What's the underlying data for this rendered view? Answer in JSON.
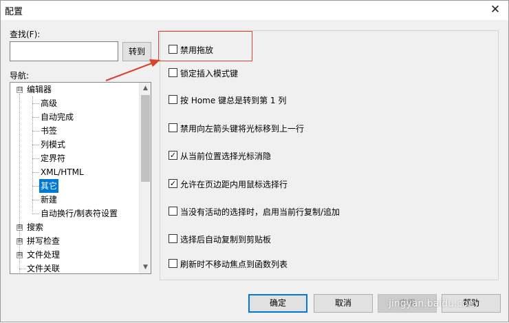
{
  "window": {
    "title": "配置",
    "close_glyph": "✕"
  },
  "search": {
    "label": "查找(F):",
    "value": "",
    "go_label": "转到"
  },
  "nav": {
    "label": "导航:",
    "items": [
      {
        "label": "编辑器",
        "expander": "⊟"
      },
      {
        "label": "高级"
      },
      {
        "label": "自动完成"
      },
      {
        "label": "书签"
      },
      {
        "label": "列模式"
      },
      {
        "label": "定界符"
      },
      {
        "label": "XML/HTML"
      },
      {
        "label": "其它"
      },
      {
        "label": "新建"
      },
      {
        "label": "自动换行/制表符设置"
      },
      {
        "label": "搜索",
        "expander": "⊞"
      },
      {
        "label": "拼写检查",
        "expander": "⊞"
      },
      {
        "label": "文件处理",
        "expander": "⊞"
      },
      {
        "label": "文件关联"
      }
    ],
    "selected_index": 7,
    "scroll_up": "▲",
    "scroll_down": "▼"
  },
  "options": [
    {
      "label": "禁用拖放",
      "checked": false
    },
    {
      "label": "锁定插入模式键",
      "checked": false
    },
    {
      "label": "按 Home 键总是转到第 1 列",
      "checked": false
    },
    {
      "label": "禁用向左箭头键将光标移到上一行",
      "checked": false
    },
    {
      "label": "从当前位置选择光标消隐",
      "checked": true
    },
    {
      "label": "允许在页边距内用鼠标选择行",
      "checked": true
    },
    {
      "label": "当没有活动的选择时，启用当前行复制/追加",
      "checked": false
    },
    {
      "label": "选择后自动复制到剪贴板",
      "checked": false
    },
    {
      "label": "刷新时不移动焦点到函数列表",
      "checked": false
    }
  ],
  "check_glyph": "✓",
  "buttons": {
    "ok": "确定",
    "cancel": "取消",
    "apply": "应用",
    "help": "帮助"
  },
  "watermark": "jingyan.baidu.com",
  "colors": {
    "annotation": "#d9432b",
    "selection": "#0078d7"
  }
}
